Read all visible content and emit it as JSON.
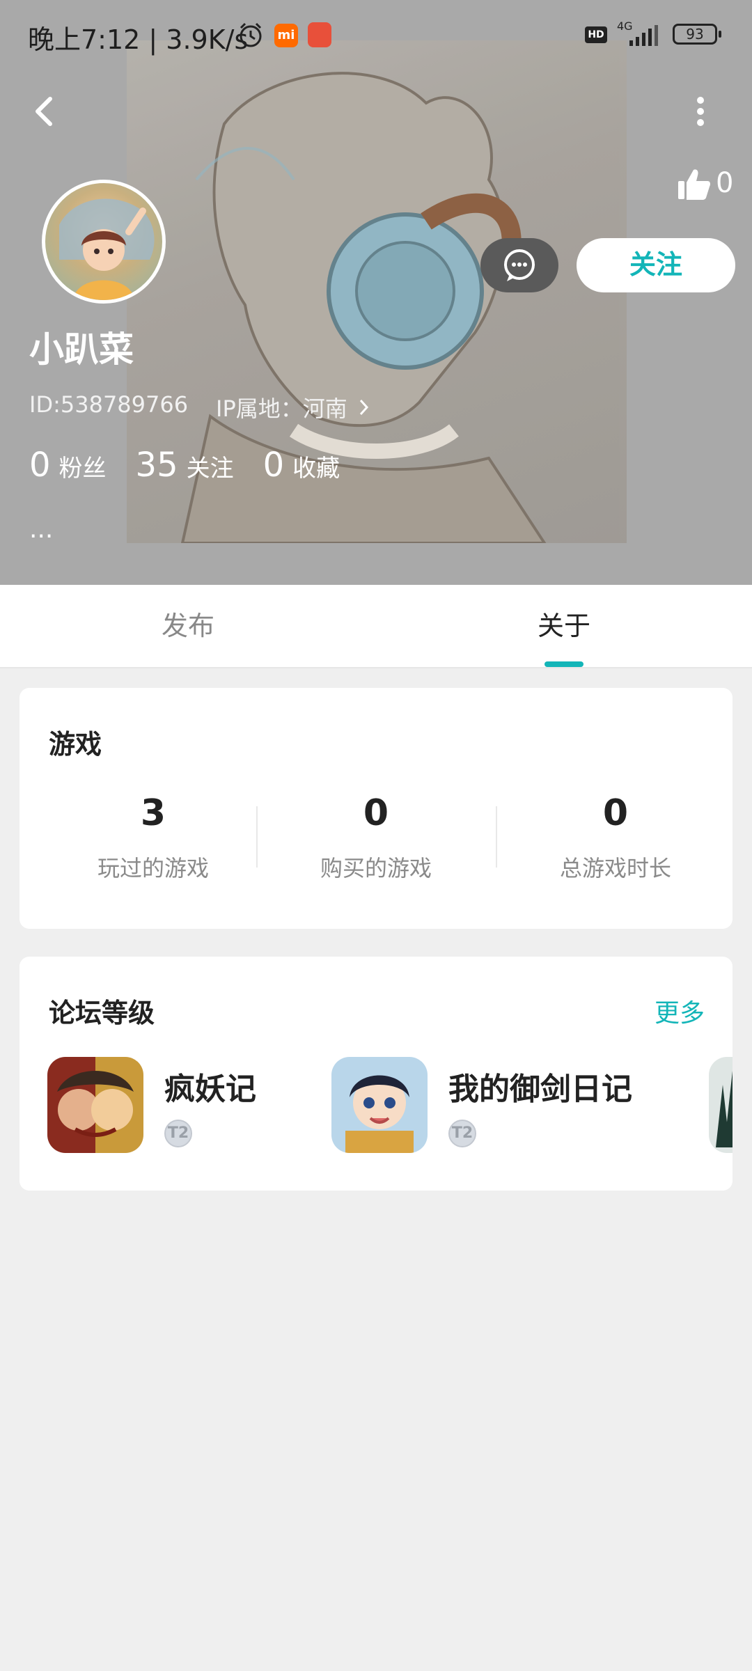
{
  "status_bar": {
    "time": "晚上7:12 | 3.9K/s",
    "hd": "HD",
    "network": "4G",
    "battery": "93"
  },
  "profile": {
    "like_count": "0",
    "username": "小趴菜",
    "id": "ID:538789766",
    "ip": "IP属地：河南",
    "fans_count": "0",
    "fans_label": "粉丝",
    "following_count": "35",
    "following_label": "关注",
    "favorites_count": "0",
    "favorites_label": "收藏",
    "bio": "...",
    "follow_button": "关注"
  },
  "tabs": [
    {
      "label": "发布"
    },
    {
      "label": "关于",
      "active": true
    }
  ],
  "games_card": {
    "title": "游戏",
    "stats": [
      {
        "value": "3",
        "label": "玩过的游戏"
      },
      {
        "value": "0",
        "label": "购买的游戏"
      },
      {
        "value": "0",
        "label": "总游戏时长"
      }
    ]
  },
  "forum_card": {
    "title": "论坛等级",
    "more": "更多",
    "items": [
      {
        "name": "疯妖记",
        "level_badge": "T2"
      },
      {
        "name": "我的御剑日记",
        "level_badge": "T2"
      }
    ]
  },
  "colors": {
    "accent": "#13b5b8",
    "header_bg": "#a9a9a9",
    "page_bg": "#efefef"
  }
}
